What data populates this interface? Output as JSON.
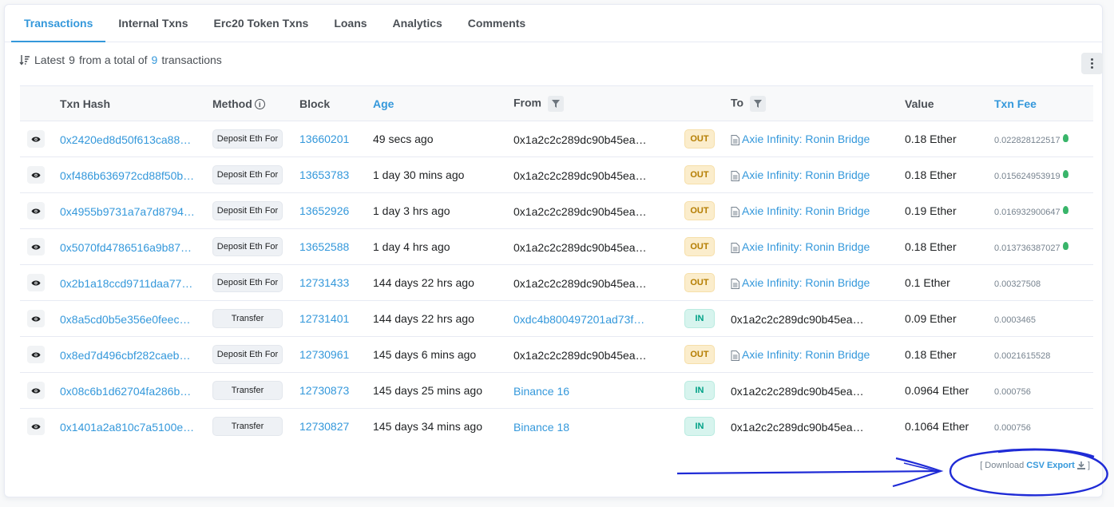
{
  "tabs": [
    {
      "label": "Transactions",
      "active": true
    },
    {
      "label": "Internal Txns"
    },
    {
      "label": "Erc20 Token Txns"
    },
    {
      "label": "Loans"
    },
    {
      "label": "Analytics"
    },
    {
      "label": "Comments"
    }
  ],
  "summary": {
    "prefix": "Latest",
    "latest": "9",
    "middle": "from a total of",
    "total": "9",
    "suffix": "transactions"
  },
  "table": {
    "headers": {
      "txn_hash": "Txn Hash",
      "method": "Method",
      "block": "Block",
      "age": "Age",
      "from": "From",
      "to": "To",
      "value": "Value",
      "txn_fee": "Txn Fee"
    },
    "rows": [
      {
        "hash": "0x2420ed8d50f613ca88…",
        "method": "Deposit Eth For",
        "block": "13660201",
        "age": "49 secs ago",
        "from": "0x1a2c2c289dc90b45ea…",
        "from_link": false,
        "dir": "OUT",
        "to": "Axie Infinity: Ronin Bridge",
        "to_contract": true,
        "value": "0.18 Ether",
        "fee": "0.022828122517",
        "bulb": true
      },
      {
        "hash": "0xf486b636972cd88f50b…",
        "method": "Deposit Eth For",
        "block": "13653783",
        "age": "1 day 30 mins ago",
        "from": "0x1a2c2c289dc90b45ea…",
        "from_link": false,
        "dir": "OUT",
        "to": "Axie Infinity: Ronin Bridge",
        "to_contract": true,
        "value": "0.18 Ether",
        "fee": "0.015624953919",
        "bulb": true
      },
      {
        "hash": "0x4955b9731a7a7d8794…",
        "method": "Deposit Eth For",
        "block": "13652926",
        "age": "1 day 3 hrs ago",
        "from": "0x1a2c2c289dc90b45ea…",
        "from_link": false,
        "dir": "OUT",
        "to": "Axie Infinity: Ronin Bridge",
        "to_contract": true,
        "value": "0.19 Ether",
        "fee": "0.016932900647",
        "bulb": true
      },
      {
        "hash": "0x5070fd4786516a9b87…",
        "method": "Deposit Eth For",
        "block": "13652588",
        "age": "1 day 4 hrs ago",
        "from": "0x1a2c2c289dc90b45ea…",
        "from_link": false,
        "dir": "OUT",
        "to": "Axie Infinity: Ronin Bridge",
        "to_contract": true,
        "value": "0.18 Ether",
        "fee": "0.013736387027",
        "bulb": true
      },
      {
        "hash": "0x2b1a18ccd9711daa77…",
        "method": "Deposit Eth For",
        "block": "12731433",
        "age": "144 days 22 hrs ago",
        "from": "0x1a2c2c289dc90b45ea…",
        "from_link": false,
        "dir": "OUT",
        "to": "Axie Infinity: Ronin Bridge",
        "to_contract": true,
        "value": "0.1 Ether",
        "fee": "0.00327508",
        "bulb": false
      },
      {
        "hash": "0x8a5cd0b5e356e0feec…",
        "method": "Transfer",
        "block": "12731401",
        "age": "144 days 22 hrs ago",
        "from": "0xdc4b800497201ad73f…",
        "from_link": true,
        "dir": "IN",
        "to": "0x1a2c2c289dc90b45ea…",
        "to_contract": false,
        "value": "0.09 Ether",
        "fee": "0.0003465",
        "bulb": false
      },
      {
        "hash": "0x8ed7d496cbf282caeb…",
        "method": "Deposit Eth For",
        "block": "12730961",
        "age": "145 days 6 mins ago",
        "from": "0x1a2c2c289dc90b45ea…",
        "from_link": false,
        "dir": "OUT",
        "to": "Axie Infinity: Ronin Bridge",
        "to_contract": true,
        "value": "0.18 Ether",
        "fee": "0.0021615528",
        "bulb": false
      },
      {
        "hash": "0x08c6b1d62704fa286b…",
        "method": "Transfer",
        "block": "12730873",
        "age": "145 days 25 mins ago",
        "from": "Binance 16",
        "from_link": true,
        "dir": "IN",
        "to": "0x1a2c2c289dc90b45ea…",
        "to_contract": false,
        "value": "0.0964 Ether",
        "fee": "0.000756",
        "bulb": false
      },
      {
        "hash": "0x1401a2a810c7a5100e…",
        "method": "Transfer",
        "block": "12730827",
        "age": "145 days 34 mins ago",
        "from": "Binance 18",
        "from_link": true,
        "dir": "IN",
        "to": "0x1a2c2c289dc90b45ea…",
        "to_contract": false,
        "value": "0.1064 Ether",
        "fee": "0.000756",
        "bulb": false
      }
    ]
  },
  "csv": {
    "open": "[ Download",
    "link": "CSV Export",
    "close": "]"
  },
  "colors": {
    "accent": "#3498db",
    "out_badge": "#fbedcc",
    "in_badge": "#d7f4ee",
    "annotation": "#1f2bd6"
  },
  "icons": [
    "sort-desc-icon",
    "more-vertical-icon",
    "eye-icon",
    "info-icon",
    "filter-icon",
    "contract-doc-icon",
    "gas-bulb-icon",
    "download-icon"
  ]
}
